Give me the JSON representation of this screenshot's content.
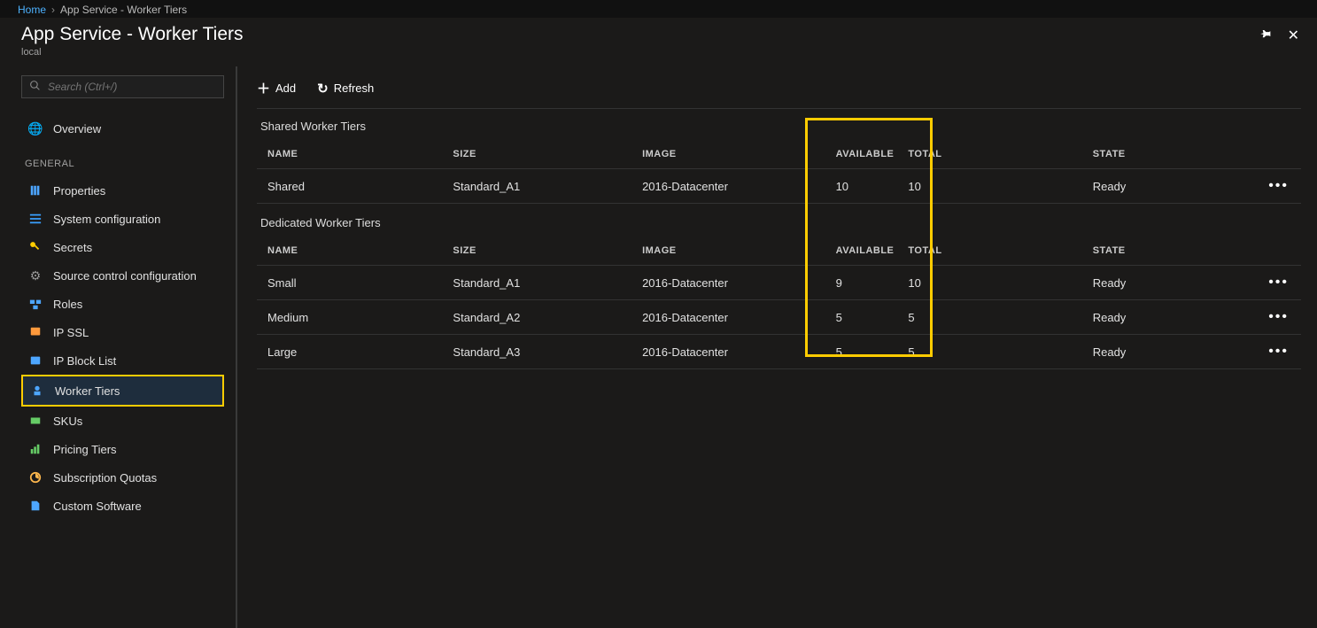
{
  "breadcrumb": {
    "home": "Home",
    "current": "App Service - Worker Tiers"
  },
  "header": {
    "title": "App Service - Worker Tiers",
    "subtitle": "local"
  },
  "search": {
    "placeholder": "Search (Ctrl+/)"
  },
  "nav": {
    "overview": "Overview",
    "section_general": "GENERAL",
    "items": {
      "properties": "Properties",
      "system_config": "System configuration",
      "secrets": "Secrets",
      "source_control": "Source control configuration",
      "roles": "Roles",
      "ip_ssl": "IP SSL",
      "ip_block": "IP Block List",
      "worker_tiers": "Worker Tiers",
      "skus": "SKUs",
      "pricing": "Pricing Tiers",
      "quotas": "Subscription Quotas",
      "custom_sw": "Custom Software"
    }
  },
  "toolbar": {
    "add_label": "Add",
    "refresh_label": "Refresh"
  },
  "columns": {
    "name": "NAME",
    "size": "SIZE",
    "image": "IMAGE",
    "available": "AVAILABLE",
    "total": "TOTAL",
    "state": "STATE"
  },
  "sections": {
    "shared_title": "Shared Worker Tiers",
    "dedicated_title": "Dedicated Worker Tiers"
  },
  "shared_rows": [
    {
      "name": "Shared",
      "size": "Standard_A1",
      "image": "2016-Datacenter",
      "available": "10",
      "total": "10",
      "state": "Ready"
    }
  ],
  "dedicated_rows": [
    {
      "name": "Small",
      "size": "Standard_A1",
      "image": "2016-Datacenter",
      "available": "9",
      "total": "10",
      "state": "Ready"
    },
    {
      "name": "Medium",
      "size": "Standard_A2",
      "image": "2016-Datacenter",
      "available": "5",
      "total": "5",
      "state": "Ready"
    },
    {
      "name": "Large",
      "size": "Standard_A3",
      "image": "2016-Datacenter",
      "available": "5",
      "total": "5",
      "state": "Ready"
    }
  ]
}
